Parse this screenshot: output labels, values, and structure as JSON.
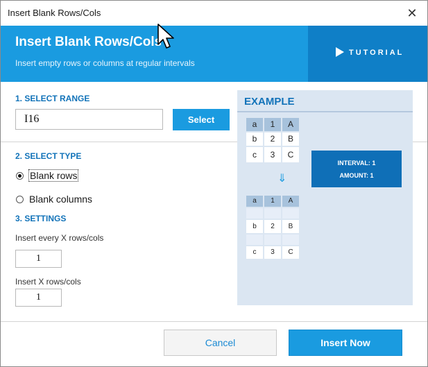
{
  "window": {
    "title": "Insert Blank Rows/Cols",
    "close_glyph": "✕"
  },
  "banner": {
    "title": "Insert Blank Rows/Cols",
    "subtitle": "Insert empty rows or columns at regular intervals",
    "tutorial_label": "TUTORIAL",
    "bg_color": "#1a9be0",
    "tutorial_bg_color": "#0f7fc7"
  },
  "range": {
    "heading": "1. SELECT RANGE",
    "value": "I16",
    "select_label": "Select"
  },
  "type": {
    "heading": "2. SELECT TYPE",
    "options": [
      {
        "label": "Blank rows",
        "checked": true
      },
      {
        "label": "Blank columns",
        "checked": false
      }
    ]
  },
  "settings": {
    "heading": "3. SETTINGS",
    "every_label": "Insert every X rows/cols",
    "every_value": "1",
    "amount_label": "Insert X rows/cols",
    "amount_value": "1"
  },
  "example": {
    "heading": "EXAMPLE",
    "before": {
      "header": [
        "a",
        "1",
        "A"
      ],
      "rows": [
        [
          "b",
          "2",
          "B"
        ],
        [
          "c",
          "3",
          "C"
        ]
      ]
    },
    "arrow": "⇓",
    "after": {
      "header": [
        "a",
        "1",
        "A"
      ],
      "rows": [
        [
          "b",
          "2",
          "B"
        ],
        [
          "c",
          "3",
          "C"
        ]
      ]
    },
    "interval_text": "INTERVAL: 1",
    "amount_text": "AMOUNT: 1"
  },
  "footer": {
    "cancel_label": "Cancel",
    "insert_label": "Insert Now"
  },
  "colors": {
    "accent": "#1a9be0",
    "heading": "#1273b9",
    "example_bg": "#dbe6f2"
  }
}
